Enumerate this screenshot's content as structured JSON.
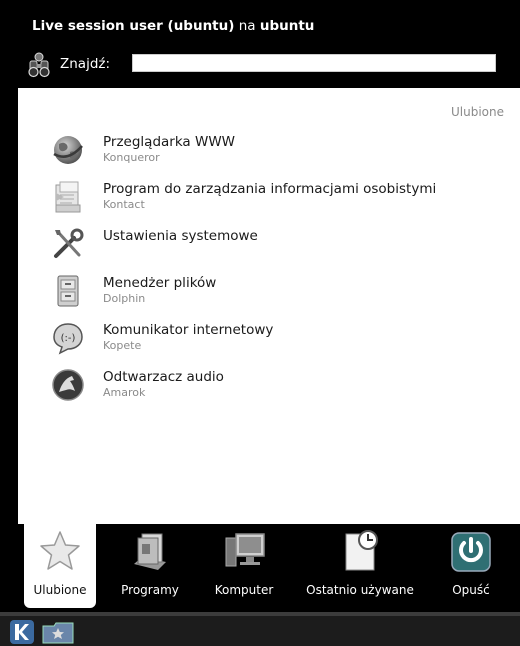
{
  "header": {
    "user_prefix": "Live session user (ubuntu)",
    "user_mid": "na",
    "host": "ubuntu"
  },
  "search": {
    "label": "Znajdź:",
    "value": "",
    "icon": "binoculars-icon"
  },
  "favorites": {
    "section_label": "Ulubione",
    "items": [
      {
        "title": "Przeglądarka WWW",
        "subtitle": "Konqueror",
        "icon": "web-browser-icon"
      },
      {
        "title": "Program do zarządzania informacjami osobistymi",
        "subtitle": "Kontact",
        "icon": "pim-icon"
      },
      {
        "title": "Ustawienia systemowe",
        "subtitle": "",
        "icon": "system-settings-icon"
      },
      {
        "title": "Menedżer plików",
        "subtitle": "Dolphin",
        "icon": "file-manager-icon"
      },
      {
        "title": "Komunikator internetowy",
        "subtitle": "Kopete",
        "icon": "instant-messenger-icon"
      },
      {
        "title": "Odtwarzacz audio",
        "subtitle": "Amarok",
        "icon": "audio-player-icon"
      }
    ]
  },
  "tabs": [
    {
      "label": "Ulubione",
      "icon": "star-icon",
      "active": true
    },
    {
      "label": "Programy",
      "icon": "applications-icon",
      "active": false
    },
    {
      "label": "Komputer",
      "icon": "computer-icon",
      "active": false
    },
    {
      "label": "Ostatnio używane",
      "icon": "recent-documents-icon",
      "active": false
    },
    {
      "label": "Opuść",
      "icon": "power-icon",
      "active": false
    }
  ],
  "taskbar": {
    "kmenu_icon": "kde-menu-icon",
    "folder_icon": "folder-view-icon"
  },
  "colors": {
    "panel_bg": "#000000",
    "content_bg": "#ffffff",
    "secondary_text": "#8a8a8a",
    "power_button": "#2f6f73"
  }
}
